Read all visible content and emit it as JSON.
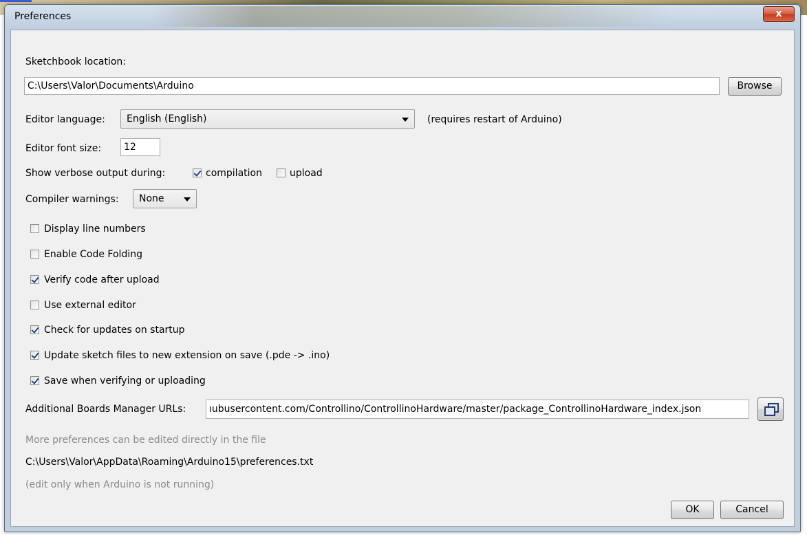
{
  "window": {
    "title": "Preferences",
    "close_glyph": "x"
  },
  "sketchbook": {
    "label": "Sketchbook location:",
    "path": "C:\\Users\\Valor\\Documents\\Arduino",
    "browse_label": "Browse"
  },
  "language": {
    "label": "Editor language:",
    "selected": "English (English)",
    "note": "(requires restart of Arduino)"
  },
  "font_size": {
    "label": "Editor font size:",
    "value": "12"
  },
  "verbose": {
    "label": "Show verbose output during:",
    "compilation_label": "compilation",
    "compilation_checked": true,
    "upload_label": "upload",
    "upload_checked": false
  },
  "warnings": {
    "label": "Compiler warnings:",
    "selected": "None"
  },
  "options": [
    {
      "label": "Display line numbers",
      "checked": false
    },
    {
      "label": "Enable Code Folding",
      "checked": false
    },
    {
      "label": "Verify code after upload",
      "checked": true
    },
    {
      "label": "Use external editor",
      "checked": false
    },
    {
      "label": "Check for updates on startup",
      "checked": true
    },
    {
      "label": "Update sketch files to new extension on save (.pde -> .ino)",
      "checked": true
    },
    {
      "label": "Save when verifying or uploading",
      "checked": true
    }
  ],
  "boards": {
    "label": "Additional Boards Manager URLs:",
    "value": "ıubusercontent.com/Controllino/ControllinoHardware/master/package_ControllinoHardware_index.json"
  },
  "footer": {
    "more_prefs": "More preferences can be edited directly in the file",
    "prefs_path": "C:\\Users\\Valor\\AppData\\Roaming\\Arduino15\\preferences.txt",
    "edit_note": "(edit only when Arduino is not running)",
    "ok_label": "OK",
    "cancel_label": "Cancel"
  },
  "colors": {
    "client_bg": "#f0f0f0",
    "check_color": "#27408b",
    "muted_text": "#8a8a8a"
  }
}
